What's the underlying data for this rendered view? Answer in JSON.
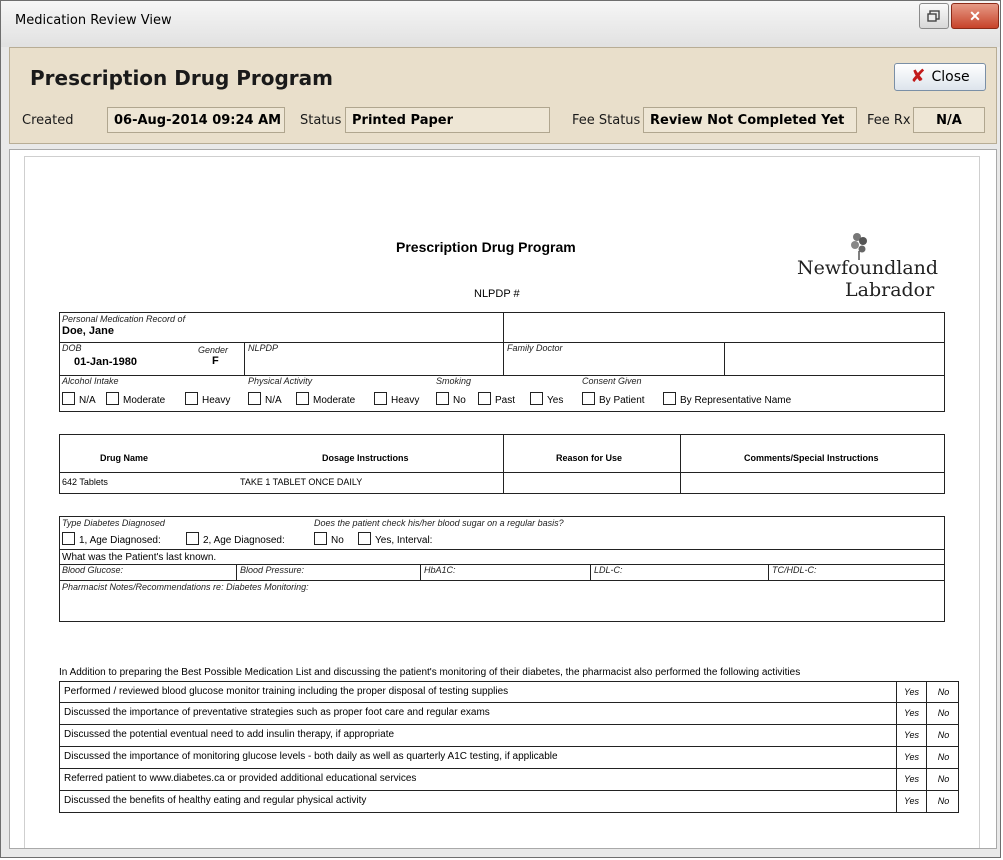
{
  "window": {
    "title": "Medication Review View"
  },
  "header": {
    "title": "Prescription Drug Program",
    "close_label": "Close",
    "created_label": "Created",
    "created_value": "06-Aug-2014 09:24 AM",
    "status_label": "Status",
    "status_value": "Printed Paper",
    "fee_status_label": "Fee Status",
    "fee_status_value": "Review Not Completed Yet",
    "fee_rx_label": "Fee Rx",
    "fee_rx_value": "N/A"
  },
  "document": {
    "title": "Prescription Drug Program",
    "nlpdp_label": "NLPDP #",
    "logo_line1": "Newfoundland",
    "logo_line2": "Labrador",
    "patient": {
      "record_label": "Personal Medication Record of",
      "name": "Doe, Jane",
      "dob_label": "DOB",
      "dob": "01-Jan-1980",
      "gender_label": "Gender",
      "gender": "F",
      "nlpdp_label": "NLPDP",
      "family_doctor_label": "Family Doctor"
    },
    "alcohol": {
      "label": "Alcohol Intake",
      "options": [
        "N/A",
        "Moderate",
        "Heavy"
      ]
    },
    "physical": {
      "label": "Physical Activity",
      "options": [
        "N/A",
        "Moderate",
        "Heavy"
      ]
    },
    "smoking": {
      "label": "Smoking",
      "options": [
        "No",
        "Past",
        "Yes"
      ]
    },
    "consent": {
      "label": "Consent Given",
      "options": [
        "By Patient",
        "By Representative  Name"
      ]
    },
    "drug_table": {
      "headers": [
        "Drug Name",
        "Dosage Instructions",
        "Reason for Use",
        "Comments/Special Instructions"
      ],
      "rows": [
        {
          "drug": "642 Tablets",
          "dosage": "TAKE 1 TABLET ONCE DAILY",
          "reason": "",
          "comments": ""
        }
      ]
    },
    "diabetes": {
      "type_label": "Type Diabetes Diagnosed",
      "type_options": [
        "1, Age Diagnosed:",
        "2, Age Diagnosed:"
      ],
      "check_label": "Does the patient check his/her blood sugar on a regular basis?",
      "check_options": [
        "No",
        "Yes, Interval:"
      ],
      "last_known": "What was the Patient's last known.",
      "measures": [
        "Blood Glucose:",
        "Blood Pressure:",
        "HbA1C:",
        "LDL-C:",
        "TC/HDL-C:"
      ],
      "notes_label": "Pharmacist Notes/Recommendations re: Diabetes Monitoring:"
    },
    "activities": {
      "intro": "In Addition to preparing the Best Possible Medication List and discussing the patient's monitoring of their diabetes, the pharmacist also performed the following activities",
      "items": [
        {
          "text": "Performed / reviewed blood glucose monitor training including the proper disposal of testing supplies",
          "yes": "Yes",
          "no": "No"
        },
        {
          "text": "Discussed the importance of preventative strategies such as proper foot care and regular exams",
          "yes": "Yes",
          "no": "No"
        },
        {
          "text": "Discussed the potential eventual need to add insulin therapy, if appropriate",
          "yes": "Yes",
          "no": "No"
        },
        {
          "text": "Discussed the importance of monitoring glucose levels - both daily as well as quarterly A1C testing, if applicable",
          "yes": "Yes",
          "no": "No"
        },
        {
          "text": "Referred patient to www.diabetes.ca or provided additional educational services",
          "yes": "Yes",
          "no": "No"
        },
        {
          "text": "Discussed the benefits of healthy eating and regular physical activity",
          "yes": "Yes",
          "no": "No"
        }
      ]
    }
  }
}
